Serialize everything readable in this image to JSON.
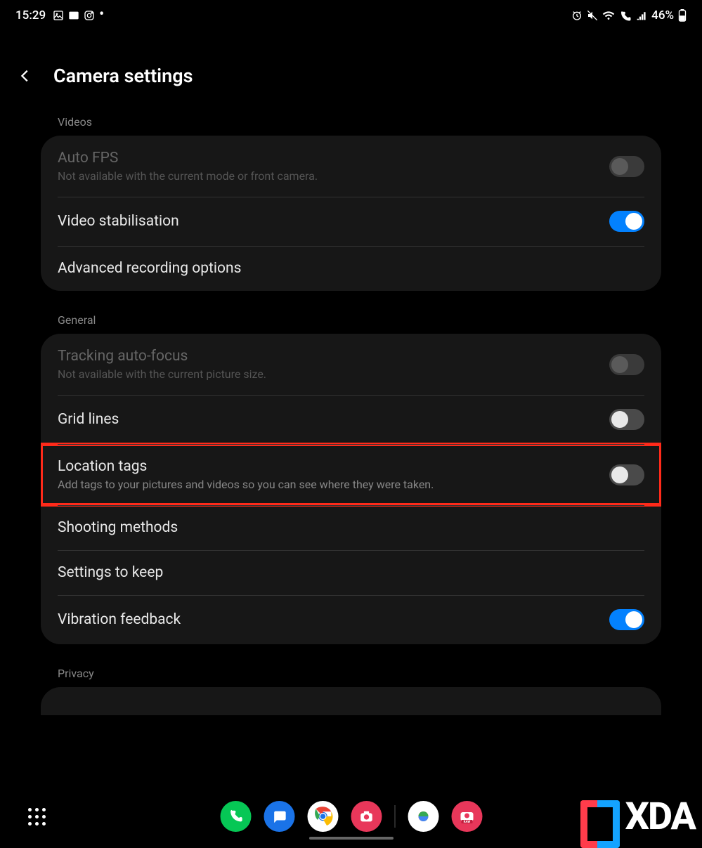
{
  "status": {
    "time": "15:29",
    "battery": "46%"
  },
  "header": {
    "title": "Camera settings"
  },
  "sections": {
    "videos": {
      "label": "Videos"
    },
    "general": {
      "label": "General"
    },
    "privacy": {
      "label": "Privacy"
    }
  },
  "rows": {
    "autofps": {
      "title": "Auto FPS",
      "sub": "Not available with the current mode or front camera."
    },
    "stabilisation": {
      "title": "Video stabilisation"
    },
    "advrec": {
      "title": "Advanced recording options"
    },
    "tracking": {
      "title": "Tracking auto-focus",
      "sub": "Not available with the current picture size."
    },
    "grid": {
      "title": "Grid lines"
    },
    "location": {
      "title": "Location tags",
      "sub": "Add tags to your pictures and videos so you can see where they were taken."
    },
    "shooting": {
      "title": "Shooting methods"
    },
    "keep": {
      "title": "Settings to keep"
    },
    "vibration": {
      "title": "Vibration feedback"
    }
  },
  "logo": {
    "text": "XDA"
  }
}
